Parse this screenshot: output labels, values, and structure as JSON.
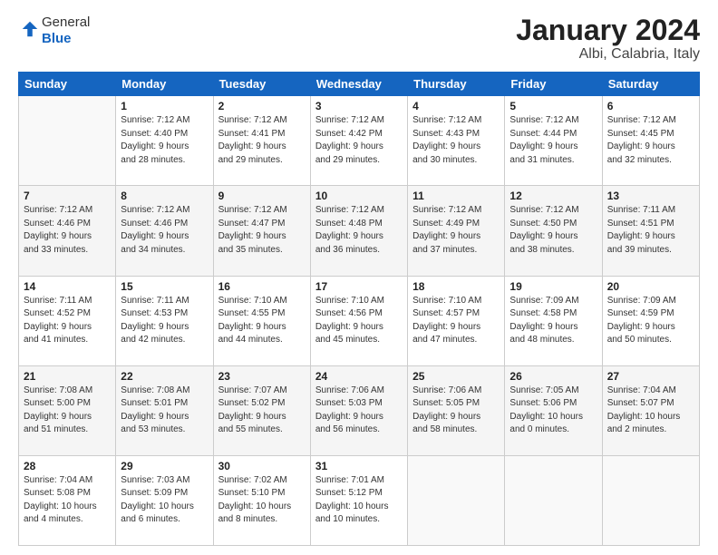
{
  "logo": {
    "general": "General",
    "blue": "Blue"
  },
  "title": "January 2024",
  "subtitle": "Albi, Calabria, Italy",
  "headers": [
    "Sunday",
    "Monday",
    "Tuesday",
    "Wednesday",
    "Thursday",
    "Friday",
    "Saturday"
  ],
  "weeks": [
    [
      {
        "day": "",
        "lines": []
      },
      {
        "day": "1",
        "lines": [
          "Sunrise: 7:12 AM",
          "Sunset: 4:40 PM",
          "Daylight: 9 hours",
          "and 28 minutes."
        ]
      },
      {
        "day": "2",
        "lines": [
          "Sunrise: 7:12 AM",
          "Sunset: 4:41 PM",
          "Daylight: 9 hours",
          "and 29 minutes."
        ]
      },
      {
        "day": "3",
        "lines": [
          "Sunrise: 7:12 AM",
          "Sunset: 4:42 PM",
          "Daylight: 9 hours",
          "and 29 minutes."
        ]
      },
      {
        "day": "4",
        "lines": [
          "Sunrise: 7:12 AM",
          "Sunset: 4:43 PM",
          "Daylight: 9 hours",
          "and 30 minutes."
        ]
      },
      {
        "day": "5",
        "lines": [
          "Sunrise: 7:12 AM",
          "Sunset: 4:44 PM",
          "Daylight: 9 hours",
          "and 31 minutes."
        ]
      },
      {
        "day": "6",
        "lines": [
          "Sunrise: 7:12 AM",
          "Sunset: 4:45 PM",
          "Daylight: 9 hours",
          "and 32 minutes."
        ]
      }
    ],
    [
      {
        "day": "7",
        "lines": [
          "Sunrise: 7:12 AM",
          "Sunset: 4:46 PM",
          "Daylight: 9 hours",
          "and 33 minutes."
        ]
      },
      {
        "day": "8",
        "lines": [
          "Sunrise: 7:12 AM",
          "Sunset: 4:46 PM",
          "Daylight: 9 hours",
          "and 34 minutes."
        ]
      },
      {
        "day": "9",
        "lines": [
          "Sunrise: 7:12 AM",
          "Sunset: 4:47 PM",
          "Daylight: 9 hours",
          "and 35 minutes."
        ]
      },
      {
        "day": "10",
        "lines": [
          "Sunrise: 7:12 AM",
          "Sunset: 4:48 PM",
          "Daylight: 9 hours",
          "and 36 minutes."
        ]
      },
      {
        "day": "11",
        "lines": [
          "Sunrise: 7:12 AM",
          "Sunset: 4:49 PM",
          "Daylight: 9 hours",
          "and 37 minutes."
        ]
      },
      {
        "day": "12",
        "lines": [
          "Sunrise: 7:12 AM",
          "Sunset: 4:50 PM",
          "Daylight: 9 hours",
          "and 38 minutes."
        ]
      },
      {
        "day": "13",
        "lines": [
          "Sunrise: 7:11 AM",
          "Sunset: 4:51 PM",
          "Daylight: 9 hours",
          "and 39 minutes."
        ]
      }
    ],
    [
      {
        "day": "14",
        "lines": [
          "Sunrise: 7:11 AM",
          "Sunset: 4:52 PM",
          "Daylight: 9 hours",
          "and 41 minutes."
        ]
      },
      {
        "day": "15",
        "lines": [
          "Sunrise: 7:11 AM",
          "Sunset: 4:53 PM",
          "Daylight: 9 hours",
          "and 42 minutes."
        ]
      },
      {
        "day": "16",
        "lines": [
          "Sunrise: 7:10 AM",
          "Sunset: 4:55 PM",
          "Daylight: 9 hours",
          "and 44 minutes."
        ]
      },
      {
        "day": "17",
        "lines": [
          "Sunrise: 7:10 AM",
          "Sunset: 4:56 PM",
          "Daylight: 9 hours",
          "and 45 minutes."
        ]
      },
      {
        "day": "18",
        "lines": [
          "Sunrise: 7:10 AM",
          "Sunset: 4:57 PM",
          "Daylight: 9 hours",
          "and 47 minutes."
        ]
      },
      {
        "day": "19",
        "lines": [
          "Sunrise: 7:09 AM",
          "Sunset: 4:58 PM",
          "Daylight: 9 hours",
          "and 48 minutes."
        ]
      },
      {
        "day": "20",
        "lines": [
          "Sunrise: 7:09 AM",
          "Sunset: 4:59 PM",
          "Daylight: 9 hours",
          "and 50 minutes."
        ]
      }
    ],
    [
      {
        "day": "21",
        "lines": [
          "Sunrise: 7:08 AM",
          "Sunset: 5:00 PM",
          "Daylight: 9 hours",
          "and 51 minutes."
        ]
      },
      {
        "day": "22",
        "lines": [
          "Sunrise: 7:08 AM",
          "Sunset: 5:01 PM",
          "Daylight: 9 hours",
          "and 53 minutes."
        ]
      },
      {
        "day": "23",
        "lines": [
          "Sunrise: 7:07 AM",
          "Sunset: 5:02 PM",
          "Daylight: 9 hours",
          "and 55 minutes."
        ]
      },
      {
        "day": "24",
        "lines": [
          "Sunrise: 7:06 AM",
          "Sunset: 5:03 PM",
          "Daylight: 9 hours",
          "and 56 minutes."
        ]
      },
      {
        "day": "25",
        "lines": [
          "Sunrise: 7:06 AM",
          "Sunset: 5:05 PM",
          "Daylight: 9 hours",
          "and 58 minutes."
        ]
      },
      {
        "day": "26",
        "lines": [
          "Sunrise: 7:05 AM",
          "Sunset: 5:06 PM",
          "Daylight: 10 hours",
          "and 0 minutes."
        ]
      },
      {
        "day": "27",
        "lines": [
          "Sunrise: 7:04 AM",
          "Sunset: 5:07 PM",
          "Daylight: 10 hours",
          "and 2 minutes."
        ]
      }
    ],
    [
      {
        "day": "28",
        "lines": [
          "Sunrise: 7:04 AM",
          "Sunset: 5:08 PM",
          "Daylight: 10 hours",
          "and 4 minutes."
        ]
      },
      {
        "day": "29",
        "lines": [
          "Sunrise: 7:03 AM",
          "Sunset: 5:09 PM",
          "Daylight: 10 hours",
          "and 6 minutes."
        ]
      },
      {
        "day": "30",
        "lines": [
          "Sunrise: 7:02 AM",
          "Sunset: 5:10 PM",
          "Daylight: 10 hours",
          "and 8 minutes."
        ]
      },
      {
        "day": "31",
        "lines": [
          "Sunrise: 7:01 AM",
          "Sunset: 5:12 PM",
          "Daylight: 10 hours",
          "and 10 minutes."
        ]
      },
      {
        "day": "",
        "lines": []
      },
      {
        "day": "",
        "lines": []
      },
      {
        "day": "",
        "lines": []
      }
    ]
  ]
}
